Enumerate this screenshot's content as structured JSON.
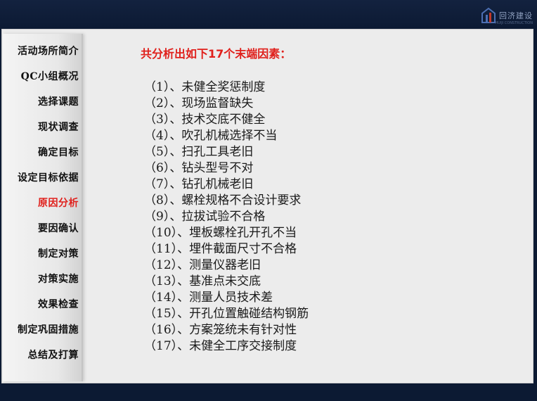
{
  "header": {
    "brand_name": "回济建设",
    "brand_sub": "HUIJI CONSTRUCTION"
  },
  "sidebar": {
    "items": [
      {
        "label": "活动场所简介",
        "active": false
      },
      {
        "label": "QC小组概况",
        "active": false
      },
      {
        "label": "选择课题",
        "active": false
      },
      {
        "label": "现状调查",
        "active": false
      },
      {
        "label": "确定目标",
        "active": false
      },
      {
        "label": "设定目标依据",
        "active": false
      },
      {
        "label": "原因分析",
        "active": true
      },
      {
        "label": "要因确认",
        "active": false
      },
      {
        "label": "制定对策",
        "active": false
      },
      {
        "label": "对策实施",
        "active": false
      },
      {
        "label": "效果检查",
        "active": false
      },
      {
        "label": "制定巩固措施",
        "active": false
      },
      {
        "label": "总结及打算",
        "active": false
      }
    ]
  },
  "main": {
    "title": "共分析出如下17个末端因素：",
    "factors": [
      "（1）、未健全奖惩制度",
      "（2）、现场监督缺失",
      "（3）、技术交底不健全",
      "（4）、吹孔机械选择不当",
      "（5）、扫孔工具老旧",
      "（6）、钻头型号不对",
      "（7）、钻孔机械老旧",
      "（8）、螺栓规格不合设计要求",
      "（9）、拉拔试验不合格",
      "（10）、埋板螺栓孔开孔不当",
      "（11）、埋件截面尺寸不合格",
      "（12）、测量仪器老旧",
      "（13）、基准点未交底",
      "（14）、测量人员技术差",
      "（15）、开孔位置触碰结构钢筋",
      "（16）、方案笼统未有针对性",
      "（17）、未健全工序交接制度"
    ]
  },
  "colors": {
    "frame": "#0c1a33",
    "panel": "#ececec",
    "accent_red": "#e0201c",
    "text": "#1a1a1a"
  }
}
